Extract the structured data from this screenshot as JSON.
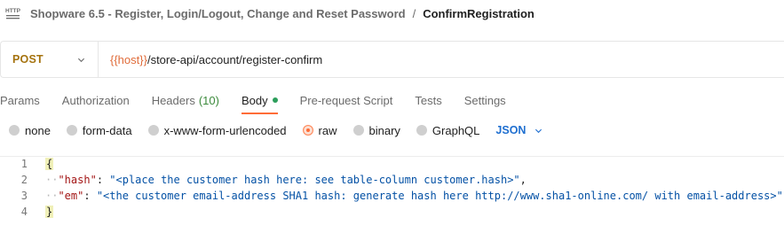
{
  "breadcrumb": {
    "icon": "http-icon",
    "parent": "Shopware 6.5 - Register, Login/Logout, Change and Reset Password",
    "separator": "/",
    "current": "ConfirmRegistration"
  },
  "request": {
    "method": "POST",
    "url_variable": "{{host}}",
    "url_path": "/store-api/account/register-confirm"
  },
  "tabs": [
    {
      "label": "Params"
    },
    {
      "label": "Authorization"
    },
    {
      "label": "Headers",
      "count": "(10)"
    },
    {
      "label": "Body",
      "active": true
    },
    {
      "label": "Pre-request Script"
    },
    {
      "label": "Tests"
    },
    {
      "label": "Settings"
    }
  ],
  "body_types": [
    {
      "label": "none",
      "selected": false
    },
    {
      "label": "form-data",
      "selected": false
    },
    {
      "label": "x-www-form-urlencoded",
      "selected": false
    },
    {
      "label": "raw",
      "selected": true
    },
    {
      "label": "binary",
      "selected": false
    },
    {
      "label": "GraphQL",
      "selected": false
    }
  ],
  "format": "JSON",
  "editor": {
    "lines": [
      {
        "num": "1",
        "open": "{"
      },
      {
        "num": "2",
        "key": "\"hash\"",
        "sep": ": ",
        "value": "\"<place the customer hash here: see table-column customer.hash>\"",
        "trail": ","
      },
      {
        "num": "3",
        "key": "\"em\"",
        "sep": ": ",
        "value": "\"<the customer email-address SHA1 hash: generate hash here http://www.sha1-online.com/ with email-address>\"",
        "trail": ""
      },
      {
        "num": "4",
        "close": "}"
      }
    ]
  },
  "colors": {
    "accent": "#ff6c37",
    "method": "#a5730f",
    "format": "#1f6fd0",
    "json_key": "#a31515",
    "json_string": "#0451a5"
  }
}
